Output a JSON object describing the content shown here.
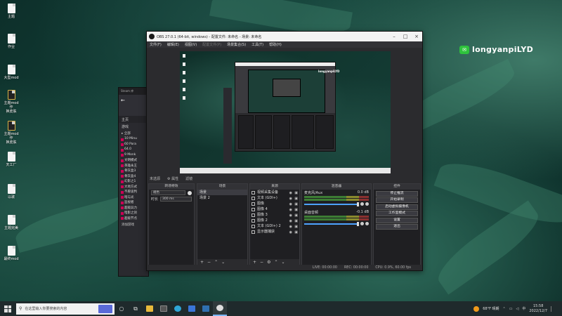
{
  "desktop": {
    "icons": [
      {
        "label": "主题",
        "dark": false
      },
      {
        "label": "作业",
        "dark": false
      },
      {
        "label": "大型mod",
        "dark": false
      },
      {
        "label": "主题mod作\n换皮肤",
        "dark": true
      },
      {
        "label": "主题mod作\n换皮肤",
        "dark": true
      },
      {
        "label": "天工厂",
        "dark": false
      },
      {
        "label": "以歌",
        "dark": false
      },
      {
        "label": "主题完美",
        "dark": false
      },
      {
        "label": "最终mod",
        "dark": false
      }
    ],
    "watermark": "longyanpiLYD"
  },
  "bg_window": {
    "top": "Steam  库",
    "nav_label": "主页",
    "search": "游戏",
    "section": "▸ 全部",
    "items": [
      "10 Minu",
      "60 Para",
      "64.0",
      "9 Monk",
      "文明模式",
      "英雄永王",
      "骨灰盒3",
      "骨灰盒4",
      "幻影之1",
      "大地方式",
      "不愿谈判",
      "暗与光",
      "监视者",
      "超级异力",
      "暗影之剑",
      "超级节点"
    ],
    "footer": "添加游戏"
  },
  "obs": {
    "title": "OBS 27.0.1 (64-bit, windows) - 配置文件: 未命名 - 场景: 未命名",
    "menu": [
      "文件(F)",
      "编辑(E)",
      "视图(V)",
      "配置文件(P)",
      "场景集合(S)",
      "工具(T)",
      "帮助(H)"
    ],
    "dock_bar": [
      "未选源",
      "⚙ 属性",
      "滤镜"
    ],
    "filter": {
      "title": "转场特效",
      "effect": "褪色",
      "duration_label": "时长",
      "duration": "300 ms"
    },
    "scenes": {
      "title": "场景",
      "items": [
        "场景",
        "场景 2"
      ]
    },
    "sources": {
      "title": "来源",
      "items": [
        "视频采集设备",
        "文本 (GDI+)",
        "图像",
        "图像 4",
        "图像 3",
        "图像 2",
        "文本 (GDI+) 2",
        "显示器捕获"
      ]
    },
    "mixer": {
      "title": "混音器",
      "channels": [
        {
          "name": "麦克风/Aux",
          "db": "0.0 dB"
        },
        {
          "name": "桌面音频",
          "db": "-0.1 dB"
        }
      ]
    },
    "controls": {
      "title": "控件",
      "buttons": [
        "停止推流",
        "开始录制",
        "启动虚拟摄像机",
        "工作室模式",
        "设置",
        "退出"
      ]
    },
    "status": {
      "live": "LIVE: 00:00:00",
      "rec": "REC: 00:00:00",
      "cpu": "CPU: 0.9%, 60.00 fps"
    }
  },
  "taskbar": {
    "search_placeholder": "在这里输入你要搜索的内容",
    "weather": "68°F 晴朗",
    "time": "15:58",
    "date": "2022/12/7"
  }
}
